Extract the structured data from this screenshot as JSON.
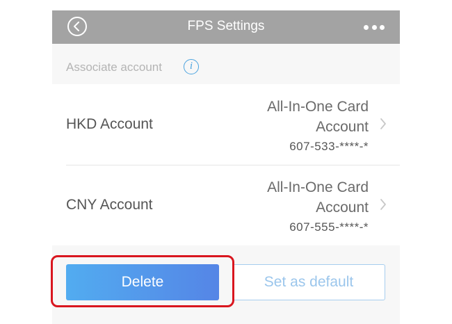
{
  "navbar": {
    "title": "FPS Settings",
    "back_icon": "back-circle-icon",
    "more_icon": "more-dots-icon"
  },
  "section": {
    "label": "Associate account",
    "info_glyph": "i"
  },
  "accounts": [
    {
      "label": "HKD Account",
      "card_line1": "All-In-One Card",
      "card_line2": "Account",
      "number": "607-533-****-*"
    },
    {
      "label": "CNY Account",
      "card_line1": "All-In-One Card",
      "card_line2": "Account",
      "number": "607-555-****-*"
    }
  ],
  "actions": {
    "delete_label": "Delete",
    "default_label": "Set as default"
  },
  "colors": {
    "navbar": "#a3a3a3",
    "accent_blue": "#5296ec",
    "highlight_red": "#d9161f"
  }
}
